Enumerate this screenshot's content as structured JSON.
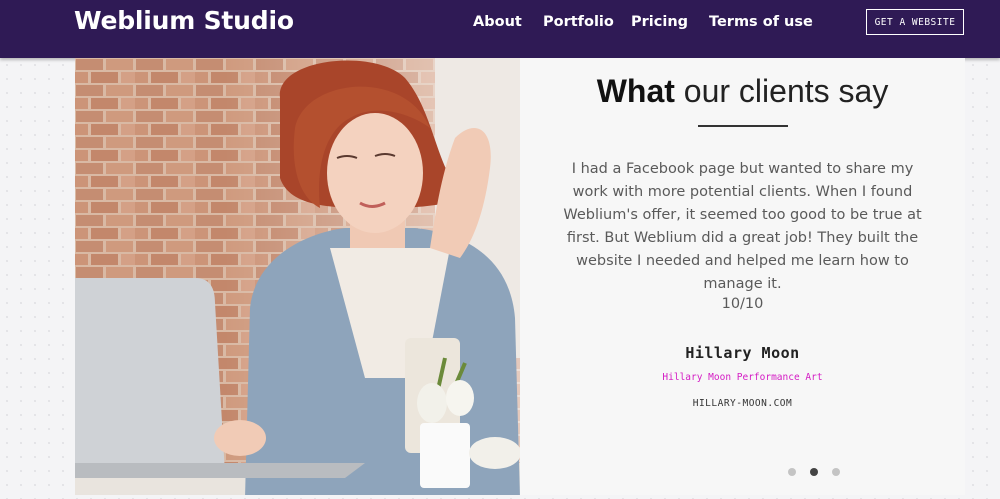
{
  "brand": {
    "name": "Weblium Studio"
  },
  "nav": {
    "links": [
      {
        "label": "About"
      },
      {
        "label": "Portfolio"
      },
      {
        "label": "Pricing"
      },
      {
        "label": "Terms of use"
      }
    ],
    "cta_label": "GET A WEBSITE"
  },
  "testimonials": {
    "heading_strong": "What",
    "heading_rest": "our clients say",
    "quote": "I had a Facebook page but wanted to share my work with more potential clients. When I found Weblium's offer, it seemed too good to be true at first. But Weblium did a great job! They built the website I needed and helped me learn how to manage it.",
    "rating": "10/10",
    "author_name": "Hillary Moon",
    "author_company": "Hillary Moon Performance Art",
    "author_site": "HILLARY-MOON.COM",
    "pager": {
      "total": 3,
      "active_index": 1
    }
  },
  "colors": {
    "navbar": "#2f1a55",
    "company_accent": "#d41cc4",
    "panel_bg": "#f7f7f7"
  }
}
